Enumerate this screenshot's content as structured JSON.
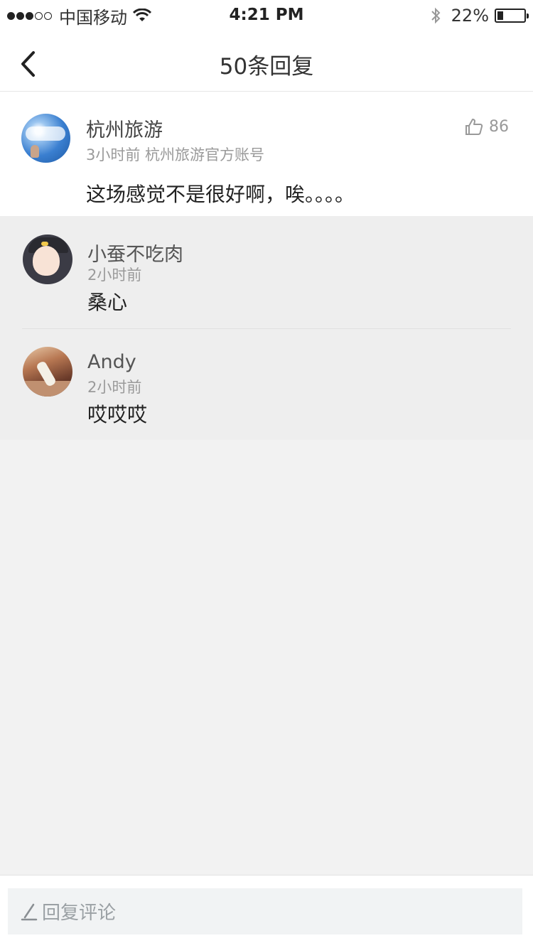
{
  "status_bar": {
    "signal_dots": [
      "on",
      "on",
      "on",
      "off",
      "off"
    ],
    "carrier": "中国移动",
    "time": "4:21 PM",
    "battery": "22%",
    "battery_level": 0.22
  },
  "nav": {
    "title": "50条回复"
  },
  "comment": {
    "author": "杭州旅游",
    "meta": "3小时前 杭州旅游官方账号",
    "likes": "86",
    "content": "这场感觉不是很好啊，唉。。。。"
  },
  "replies": [
    {
      "author": "小蚕不吃肉",
      "time": "2小时前",
      "content": "桑心"
    },
    {
      "author": "Andy",
      "time": "2小时前",
      "content": "哎哎哎"
    }
  ],
  "input": {
    "placeholder": "回复评论"
  },
  "colors": {
    "page_bg": "#f2f2f2",
    "reply_bg": "#eeeeee",
    "input_bg": "#f1f3f4",
    "muted_text": "#9a9a9a"
  }
}
